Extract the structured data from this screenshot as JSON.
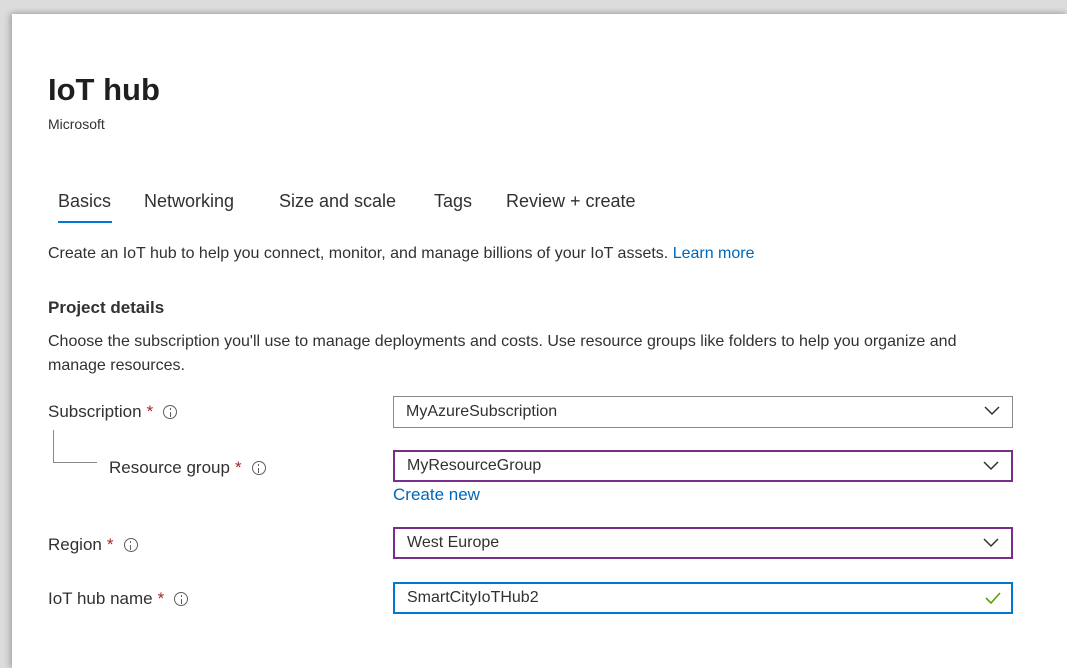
{
  "header": {
    "title": "IoT hub",
    "publisher": "Microsoft"
  },
  "tabs": [
    {
      "label": "Basics",
      "active": true
    },
    {
      "label": "Networking"
    },
    {
      "label": "Size and scale"
    },
    {
      "label": "Tags"
    },
    {
      "label": "Review + create"
    }
  ],
  "intro": {
    "text": "Create an IoT hub to help you connect, monitor, and manage billions of your IoT assets.",
    "link": "Learn more"
  },
  "project": {
    "heading": "Project details",
    "description": "Choose the subscription you'll use to manage deployments and costs. Use resource groups like folders to help you organize and manage resources."
  },
  "fields": {
    "subscription": {
      "label": "Subscription",
      "required_mark": "*",
      "value": "MyAzureSubscription"
    },
    "resource_group": {
      "label": "Resource group",
      "required_mark": "*",
      "value": "MyResourceGroup",
      "create_new": "Create new"
    },
    "region": {
      "label": "Region",
      "required_mark": "*",
      "value": "West Europe"
    },
    "hub_name": {
      "label": "IoT hub name",
      "required_mark": "*",
      "value": "SmartCityIoTHub2",
      "valid": true
    }
  },
  "colors": {
    "accent": "#0078d4",
    "link": "#0067b8",
    "required": "#a4262c",
    "focus_purple": "#7a2e8b",
    "valid_check": "#57a300"
  }
}
